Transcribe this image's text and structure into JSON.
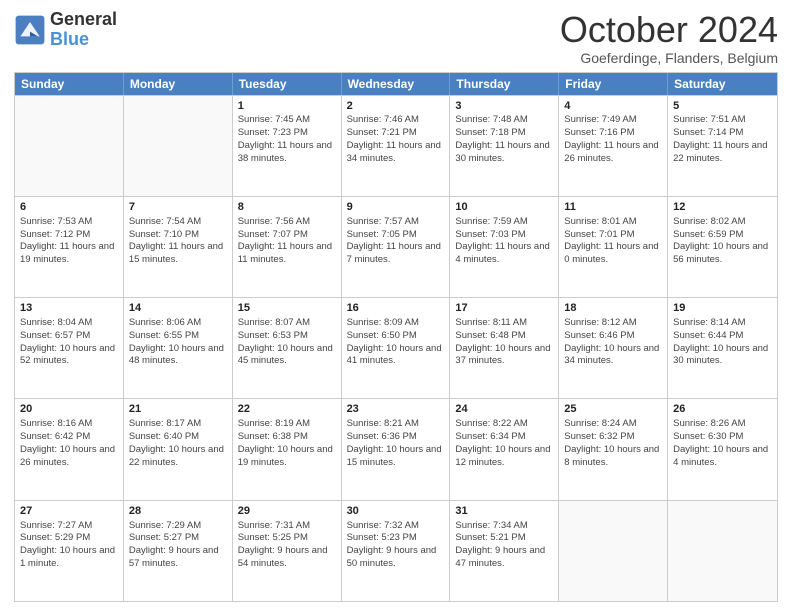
{
  "header": {
    "logo_general": "General",
    "logo_blue": "Blue",
    "month_title": "October 2024",
    "location": "Goeferdinge, Flanders, Belgium"
  },
  "weekdays": [
    "Sunday",
    "Monday",
    "Tuesday",
    "Wednesday",
    "Thursday",
    "Friday",
    "Saturday"
  ],
  "weeks": [
    [
      {
        "day": "",
        "sunrise": "",
        "sunset": "",
        "daylight": "",
        "empty": true
      },
      {
        "day": "",
        "sunrise": "",
        "sunset": "",
        "daylight": "",
        "empty": true
      },
      {
        "day": "1",
        "sunrise": "Sunrise: 7:45 AM",
        "sunset": "Sunset: 7:23 PM",
        "daylight": "Daylight: 11 hours and 38 minutes.",
        "empty": false
      },
      {
        "day": "2",
        "sunrise": "Sunrise: 7:46 AM",
        "sunset": "Sunset: 7:21 PM",
        "daylight": "Daylight: 11 hours and 34 minutes.",
        "empty": false
      },
      {
        "day": "3",
        "sunrise": "Sunrise: 7:48 AM",
        "sunset": "Sunset: 7:18 PM",
        "daylight": "Daylight: 11 hours and 30 minutes.",
        "empty": false
      },
      {
        "day": "4",
        "sunrise": "Sunrise: 7:49 AM",
        "sunset": "Sunset: 7:16 PM",
        "daylight": "Daylight: 11 hours and 26 minutes.",
        "empty": false
      },
      {
        "day": "5",
        "sunrise": "Sunrise: 7:51 AM",
        "sunset": "Sunset: 7:14 PM",
        "daylight": "Daylight: 11 hours and 22 minutes.",
        "empty": false
      }
    ],
    [
      {
        "day": "6",
        "sunrise": "Sunrise: 7:53 AM",
        "sunset": "Sunset: 7:12 PM",
        "daylight": "Daylight: 11 hours and 19 minutes.",
        "empty": false
      },
      {
        "day": "7",
        "sunrise": "Sunrise: 7:54 AM",
        "sunset": "Sunset: 7:10 PM",
        "daylight": "Daylight: 11 hours and 15 minutes.",
        "empty": false
      },
      {
        "day": "8",
        "sunrise": "Sunrise: 7:56 AM",
        "sunset": "Sunset: 7:07 PM",
        "daylight": "Daylight: 11 hours and 11 minutes.",
        "empty": false
      },
      {
        "day": "9",
        "sunrise": "Sunrise: 7:57 AM",
        "sunset": "Sunset: 7:05 PM",
        "daylight": "Daylight: 11 hours and 7 minutes.",
        "empty": false
      },
      {
        "day": "10",
        "sunrise": "Sunrise: 7:59 AM",
        "sunset": "Sunset: 7:03 PM",
        "daylight": "Daylight: 11 hours and 4 minutes.",
        "empty": false
      },
      {
        "day": "11",
        "sunrise": "Sunrise: 8:01 AM",
        "sunset": "Sunset: 7:01 PM",
        "daylight": "Daylight: 11 hours and 0 minutes.",
        "empty": false
      },
      {
        "day": "12",
        "sunrise": "Sunrise: 8:02 AM",
        "sunset": "Sunset: 6:59 PM",
        "daylight": "Daylight: 10 hours and 56 minutes.",
        "empty": false
      }
    ],
    [
      {
        "day": "13",
        "sunrise": "Sunrise: 8:04 AM",
        "sunset": "Sunset: 6:57 PM",
        "daylight": "Daylight: 10 hours and 52 minutes.",
        "empty": false
      },
      {
        "day": "14",
        "sunrise": "Sunrise: 8:06 AM",
        "sunset": "Sunset: 6:55 PM",
        "daylight": "Daylight: 10 hours and 48 minutes.",
        "empty": false
      },
      {
        "day": "15",
        "sunrise": "Sunrise: 8:07 AM",
        "sunset": "Sunset: 6:53 PM",
        "daylight": "Daylight: 10 hours and 45 minutes.",
        "empty": false
      },
      {
        "day": "16",
        "sunrise": "Sunrise: 8:09 AM",
        "sunset": "Sunset: 6:50 PM",
        "daylight": "Daylight: 10 hours and 41 minutes.",
        "empty": false
      },
      {
        "day": "17",
        "sunrise": "Sunrise: 8:11 AM",
        "sunset": "Sunset: 6:48 PM",
        "daylight": "Daylight: 10 hours and 37 minutes.",
        "empty": false
      },
      {
        "day": "18",
        "sunrise": "Sunrise: 8:12 AM",
        "sunset": "Sunset: 6:46 PM",
        "daylight": "Daylight: 10 hours and 34 minutes.",
        "empty": false
      },
      {
        "day": "19",
        "sunrise": "Sunrise: 8:14 AM",
        "sunset": "Sunset: 6:44 PM",
        "daylight": "Daylight: 10 hours and 30 minutes.",
        "empty": false
      }
    ],
    [
      {
        "day": "20",
        "sunrise": "Sunrise: 8:16 AM",
        "sunset": "Sunset: 6:42 PM",
        "daylight": "Daylight: 10 hours and 26 minutes.",
        "empty": false
      },
      {
        "day": "21",
        "sunrise": "Sunrise: 8:17 AM",
        "sunset": "Sunset: 6:40 PM",
        "daylight": "Daylight: 10 hours and 22 minutes.",
        "empty": false
      },
      {
        "day": "22",
        "sunrise": "Sunrise: 8:19 AM",
        "sunset": "Sunset: 6:38 PM",
        "daylight": "Daylight: 10 hours and 19 minutes.",
        "empty": false
      },
      {
        "day": "23",
        "sunrise": "Sunrise: 8:21 AM",
        "sunset": "Sunset: 6:36 PM",
        "daylight": "Daylight: 10 hours and 15 minutes.",
        "empty": false
      },
      {
        "day": "24",
        "sunrise": "Sunrise: 8:22 AM",
        "sunset": "Sunset: 6:34 PM",
        "daylight": "Daylight: 10 hours and 12 minutes.",
        "empty": false
      },
      {
        "day": "25",
        "sunrise": "Sunrise: 8:24 AM",
        "sunset": "Sunset: 6:32 PM",
        "daylight": "Daylight: 10 hours and 8 minutes.",
        "empty": false
      },
      {
        "day": "26",
        "sunrise": "Sunrise: 8:26 AM",
        "sunset": "Sunset: 6:30 PM",
        "daylight": "Daylight: 10 hours and 4 minutes.",
        "empty": false
      }
    ],
    [
      {
        "day": "27",
        "sunrise": "Sunrise: 7:27 AM",
        "sunset": "Sunset: 5:29 PM",
        "daylight": "Daylight: 10 hours and 1 minute.",
        "empty": false
      },
      {
        "day": "28",
        "sunrise": "Sunrise: 7:29 AM",
        "sunset": "Sunset: 5:27 PM",
        "daylight": "Daylight: 9 hours and 57 minutes.",
        "empty": false
      },
      {
        "day": "29",
        "sunrise": "Sunrise: 7:31 AM",
        "sunset": "Sunset: 5:25 PM",
        "daylight": "Daylight: 9 hours and 54 minutes.",
        "empty": false
      },
      {
        "day": "30",
        "sunrise": "Sunrise: 7:32 AM",
        "sunset": "Sunset: 5:23 PM",
        "daylight": "Daylight: 9 hours and 50 minutes.",
        "empty": false
      },
      {
        "day": "31",
        "sunrise": "Sunrise: 7:34 AM",
        "sunset": "Sunset: 5:21 PM",
        "daylight": "Daylight: 9 hours and 47 minutes.",
        "empty": false
      },
      {
        "day": "",
        "sunrise": "",
        "sunset": "",
        "daylight": "",
        "empty": true
      },
      {
        "day": "",
        "sunrise": "",
        "sunset": "",
        "daylight": "",
        "empty": true
      }
    ]
  ]
}
